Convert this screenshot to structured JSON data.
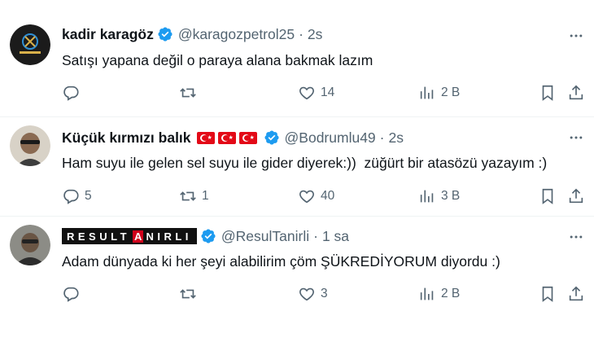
{
  "tweets": [
    {
      "name": "kadir karagöz",
      "handle": "@karagozpetrol25",
      "time": "2s",
      "text": "Satışı yapana değil o paraya alana bakmak lazım",
      "replies": "",
      "retweets": "",
      "likes": "14",
      "views": "2 B"
    },
    {
      "name": "Küçük kırmızı balık",
      "handle": "@Bodrumlu49",
      "time": "2s",
      "text": "Ham suyu ile gelen sel suyu ile gider diyerek:))  züğürt bir atasözü yazayım :)",
      "replies": "5",
      "retweets": "1",
      "likes": "40",
      "views": "3 B"
    },
    {
      "name": "RESULTANIRLI",
      "name_before": "RESULT",
      "name_highlight": "A",
      "name_after": "NIRLI",
      "handle": "@ResulTanirli",
      "time": "1 sa",
      "text": "Adam dünyada ki her şeyi alabilirim çöm ŞÜKREDİYORUM diyordu :)",
      "replies": "",
      "retweets": "",
      "likes": "3",
      "views": "2 B"
    }
  ],
  "separator": "·",
  "colors": {
    "verified": "#1d9bf0",
    "secondary_text": "#536471",
    "divider": "#eff3f4",
    "flag_red": "#e30a17"
  },
  "icons": [
    "verified-badge-icon",
    "more-icon",
    "reply-icon",
    "retweet-icon",
    "like-icon",
    "views-icon",
    "bookmark-icon",
    "share-icon",
    "turkish-flag-icon"
  ]
}
